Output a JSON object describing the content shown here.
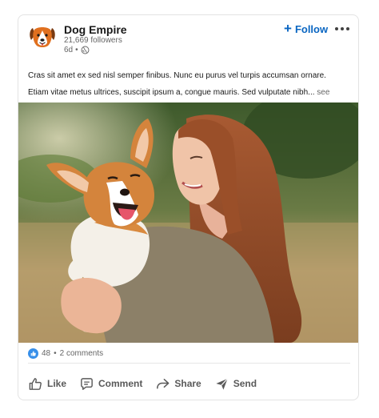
{
  "company": {
    "name": "Dog Empire",
    "followers": "21,669 followers",
    "age": "6d",
    "separator": "•",
    "logo_icon": "dog-face-icon"
  },
  "follow_button": {
    "plus": "+",
    "label": "Follow"
  },
  "more_icon": "more-horizontal-icon",
  "post": {
    "text": "Cras sit amet ex sed nisl semper finibus. Nunc eu purus vel turpis accumsan ornare. Etiam vitae metus ultrices, suscipit ipsum a, congue mauris. Sed vulputate nibh...",
    "see_more": "see more",
    "image_icon": "woman-holding-corgi-photo"
  },
  "social": {
    "reactions": "48",
    "separator": "•",
    "comments": "2 comments"
  },
  "actions": [
    {
      "label": "Like",
      "icon": "thumbs-up-icon"
    },
    {
      "label": "Comment",
      "icon": "comment-icon"
    },
    {
      "label": "Share",
      "icon": "share-arrow-icon"
    },
    {
      "label": "Send",
      "icon": "send-icon"
    }
  ],
  "colors": {
    "accent": "#0a66c2",
    "reaction": "#378fe9",
    "border": "#e3e3e3"
  }
}
